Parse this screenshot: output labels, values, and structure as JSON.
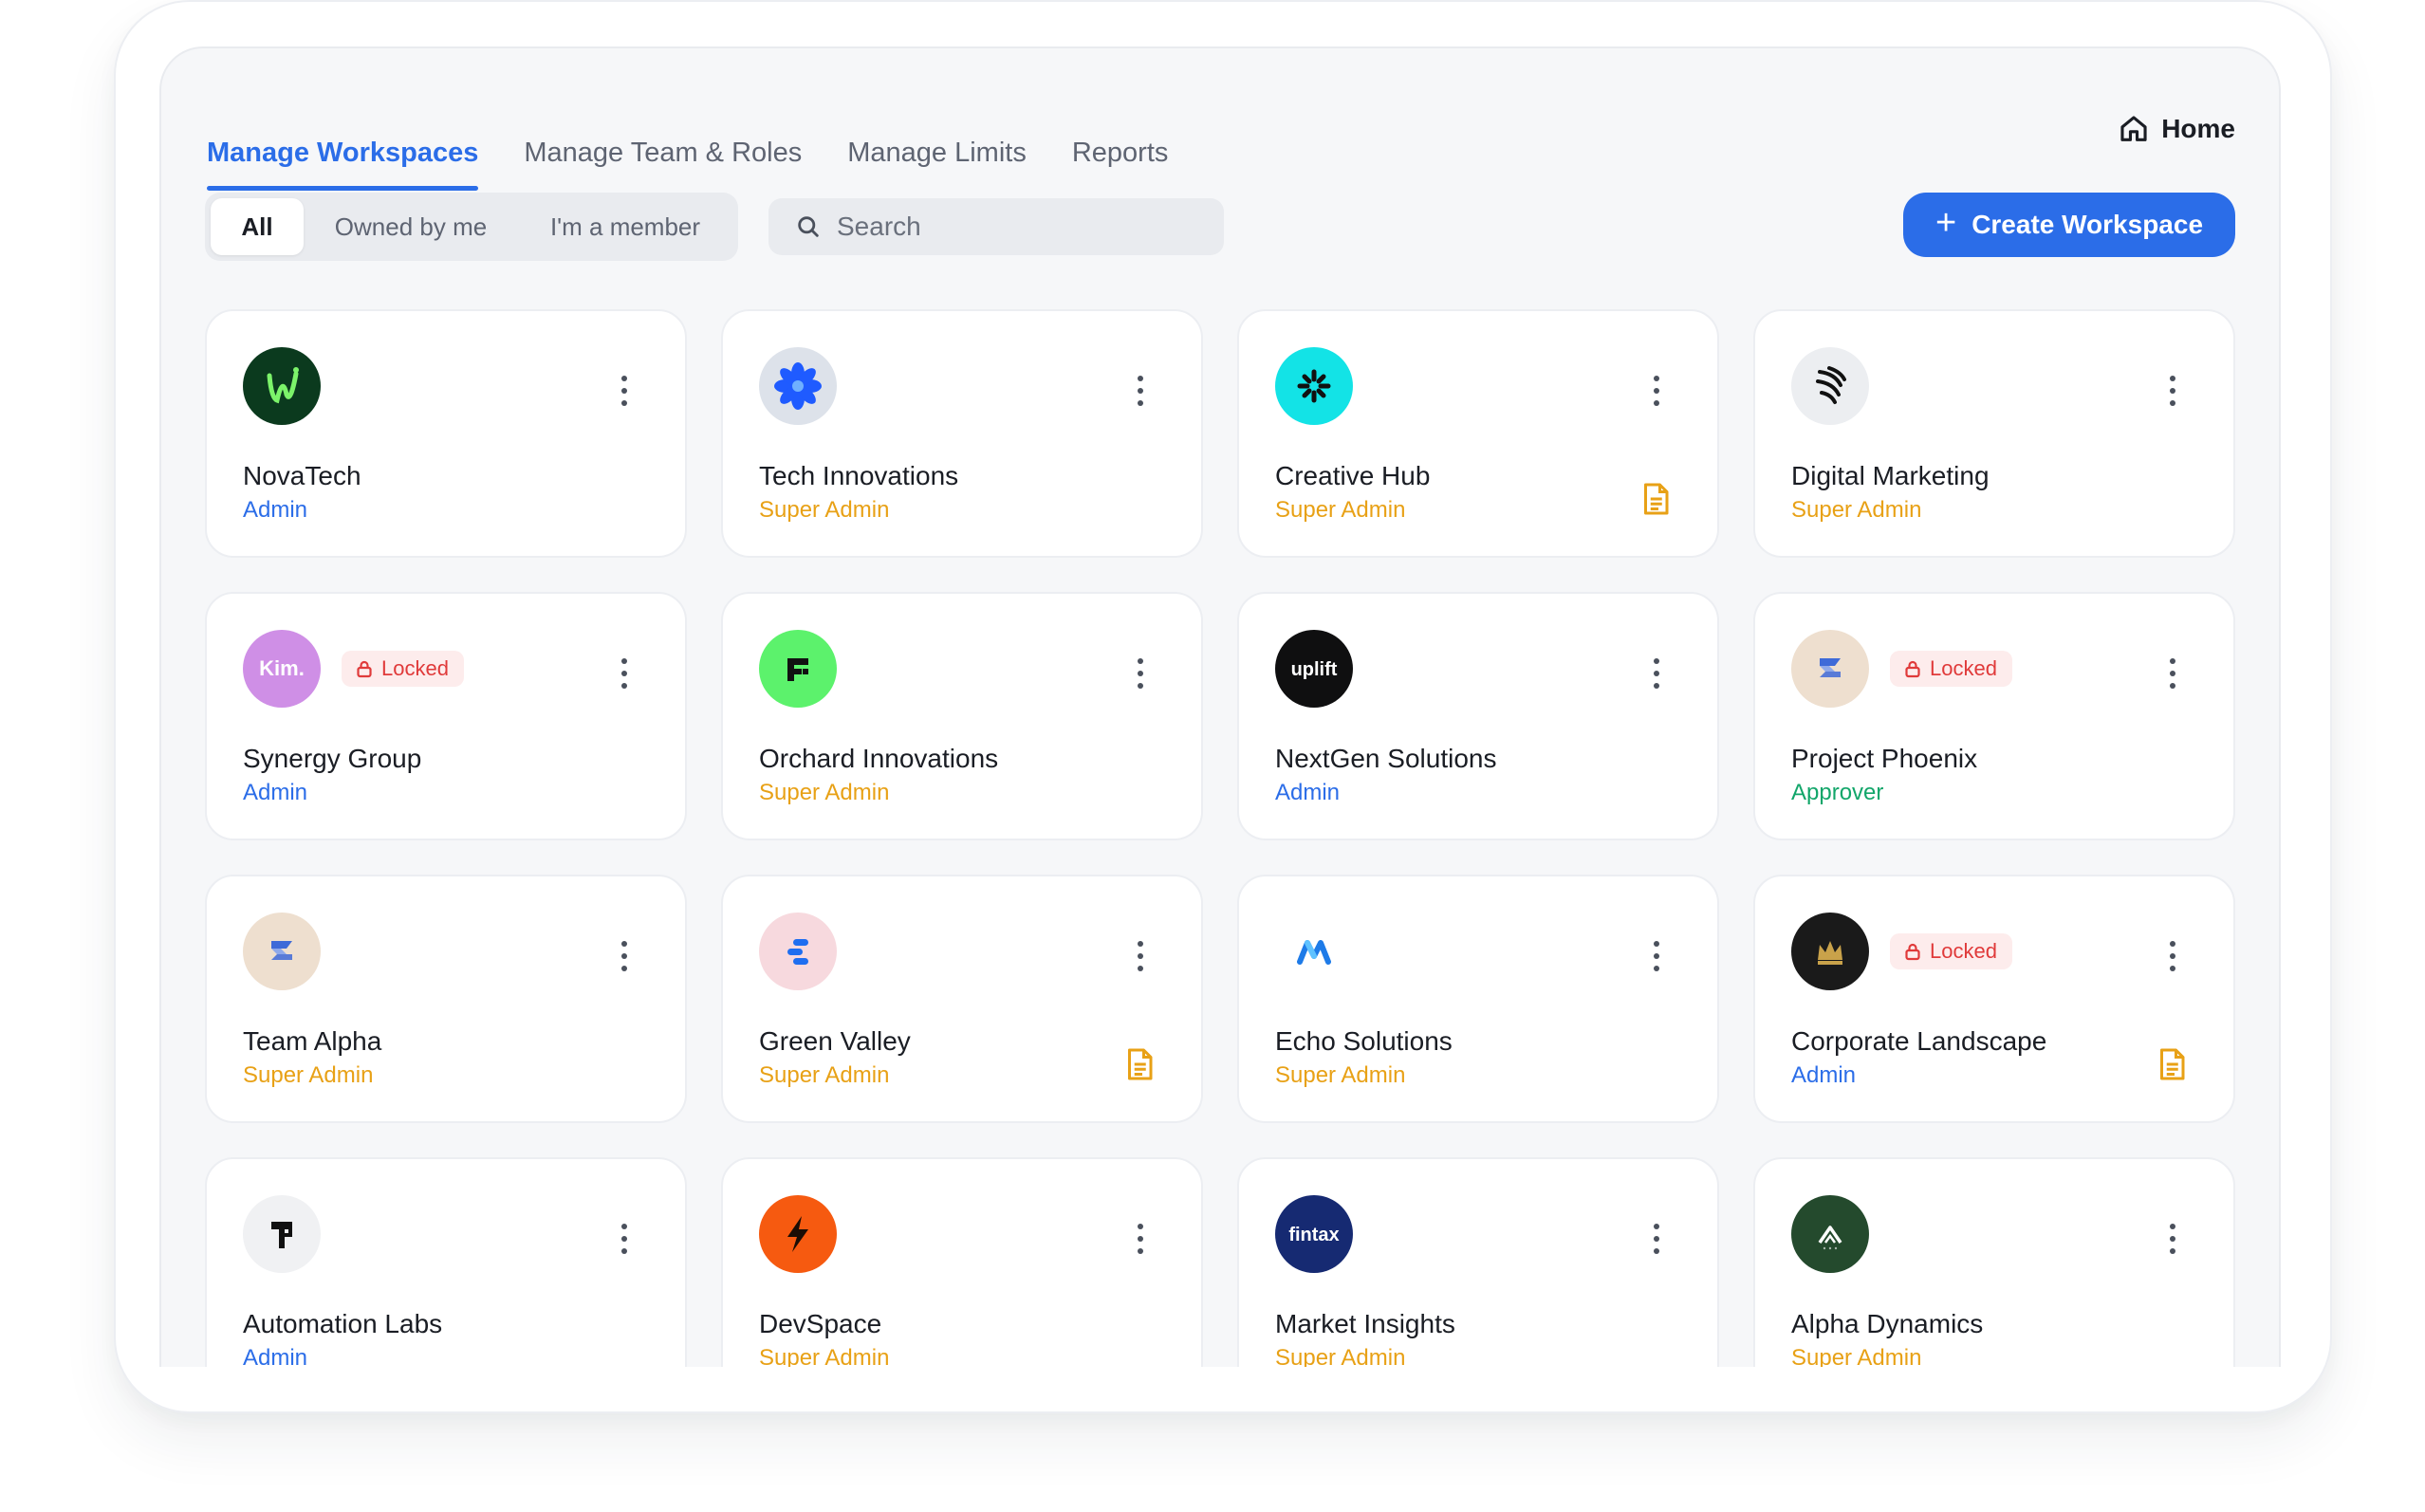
{
  "tabs": [
    {
      "label": "Manage Workspaces",
      "active": true
    },
    {
      "label": "Manage Team & Roles",
      "active": false
    },
    {
      "label": "Manage Limits",
      "active": false
    },
    {
      "label": "Reports",
      "active": false
    }
  ],
  "home": {
    "label": "Home",
    "icon": "home-icon"
  },
  "filters": [
    {
      "label": "All",
      "active": true
    },
    {
      "label": "Owned by me",
      "active": false
    },
    {
      "label": "I'm a member",
      "active": false
    }
  ],
  "search": {
    "placeholder": "Search",
    "value": "",
    "icon": "search-icon"
  },
  "create_button": {
    "label": "Create Workspace",
    "icon": "plus-icon"
  },
  "locked_label": "Locked",
  "colors": {
    "accent": "#2b6de8",
    "role_admin": "#2b6de8",
    "role_super_admin": "#e8a116",
    "role_approver": "#12a66a",
    "locked": "#e03a3a"
  },
  "workspaces": [
    {
      "name": "NovaTech",
      "role": "Admin",
      "role_type": "admin",
      "logo": "novatech-logo",
      "logo_text": "",
      "locked": false,
      "document": false
    },
    {
      "name": "Tech Innovations",
      "role": "Super Admin",
      "role_type": "super",
      "logo": "blue-flower-logo",
      "logo_text": "",
      "locked": false,
      "document": false
    },
    {
      "name": "Creative Hub",
      "role": "Super Admin",
      "role_type": "super",
      "logo": "cyan-burst-logo",
      "logo_text": "",
      "locked": false,
      "document": true
    },
    {
      "name": "Digital Marketing",
      "role": "Super Admin",
      "role_type": "super",
      "logo": "black-swirl-logo",
      "logo_text": "",
      "locked": false,
      "document": false
    },
    {
      "name": "Synergy Group",
      "role": "Admin",
      "role_type": "admin",
      "logo": "kim-logo",
      "logo_text": "Kim.",
      "locked": true,
      "document": false
    },
    {
      "name": "Orchard Innovations",
      "role": "Super Admin",
      "role_type": "super",
      "logo": "green-f-logo",
      "logo_text": "",
      "locked": false,
      "document": false
    },
    {
      "name": "NextGen Solutions",
      "role": "Admin",
      "role_type": "admin",
      "logo": "uplift-logo",
      "logo_text": "uplift",
      "locked": false,
      "document": false
    },
    {
      "name": "Project Phoenix",
      "role": "Approver",
      "role_type": "approver",
      "logo": "blue-s-logo",
      "logo_text": "",
      "locked": true,
      "document": false
    },
    {
      "name": "Team Alpha",
      "role": "Super Admin",
      "role_type": "super",
      "logo": "blue-s-logo",
      "logo_text": "",
      "locked": false,
      "document": false
    },
    {
      "name": "Green Valley",
      "role": "Super Admin",
      "role_type": "super",
      "logo": "blue-stack-logo",
      "logo_text": "",
      "locked": false,
      "document": true
    },
    {
      "name": "Echo Solutions",
      "role": "Super Admin",
      "role_type": "super",
      "logo": "blue-m-logo",
      "logo_text": "",
      "locked": false,
      "document": false
    },
    {
      "name": "Corporate Landscape",
      "role": "Admin",
      "role_type": "admin",
      "logo": "crown-logo",
      "logo_text": "",
      "locked": true,
      "document": true
    },
    {
      "name": "Automation Labs",
      "role": "Admin",
      "role_type": "admin",
      "logo": "black-p-logo",
      "logo_text": "",
      "locked": false,
      "document": false
    },
    {
      "name": "DevSpace",
      "role": "Super Admin",
      "role_type": "super",
      "logo": "orange-bolt-logo",
      "logo_text": "",
      "locked": false,
      "document": false
    },
    {
      "name": "Market Insights",
      "role": "Super Admin",
      "role_type": "super",
      "logo": "fintax-logo",
      "logo_text": "fintax",
      "locked": false,
      "document": false
    },
    {
      "name": "Alpha Dynamics",
      "role": "Super Admin",
      "role_type": "super",
      "logo": "mountain-logo",
      "logo_text": "",
      "locked": false,
      "document": false
    }
  ]
}
